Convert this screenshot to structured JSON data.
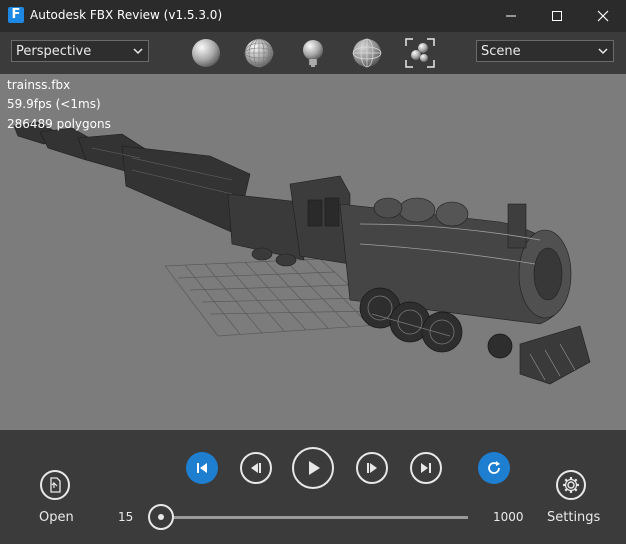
{
  "window": {
    "title": "Autodesk FBX Review (v1.5.3.0)",
    "logo_letter": "F",
    "controls": [
      "minimize-icon",
      "maximize-icon",
      "close-icon"
    ]
  },
  "toolbar": {
    "camera_select": {
      "value": "Perspective"
    },
    "scene_select": {
      "value": "Scene"
    },
    "display_modes": [
      "shaded-sphere-icon",
      "wireframe-shaded-sphere-icon",
      "lighting-bulb-icon",
      "wireframe-sphere-icon",
      "frame-all-icon"
    ]
  },
  "viewport": {
    "file_name": "trainss.fbx",
    "fps": "59.9fps (<1ms)",
    "polygons": "286489 polygons"
  },
  "playback": {
    "buttons": [
      "go-to-start-icon",
      "previous-frame-icon",
      "play-icon",
      "next-frame-icon",
      "go-to-end-icon",
      "loop-icon"
    ],
    "open_label": "Open",
    "settings_label": "Settings",
    "start_frame": "15",
    "end_frame": "1000",
    "current_position": 0.0
  },
  "colors": {
    "accent": "#1e7fd0",
    "viewport_bg": "#7c7c7c",
    "chrome_bg": "#3b3b3b",
    "titlebar_bg": "#2b2b2b"
  }
}
